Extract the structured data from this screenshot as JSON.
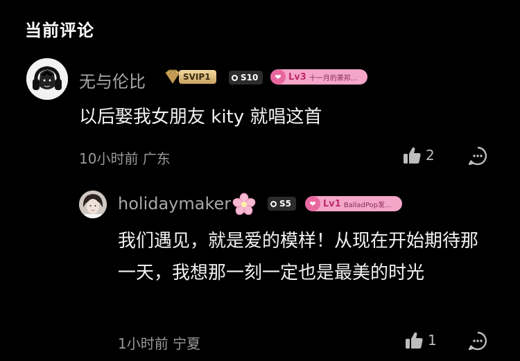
{
  "header": {
    "title": "当前评论"
  },
  "comment": {
    "username": "无与伦比",
    "svip_label": "SVIP1",
    "s_badge": "S10",
    "level": "Lv3",
    "level_name": "十一月的萧邦...",
    "text": "以后娶我女朋友 kity 就唱这首",
    "meta": "10小时前 广东",
    "likes": "2"
  },
  "reply": {
    "username": "holidaymaker",
    "s_badge": "S5",
    "level": "Lv1",
    "level_name": "BalladPop发...",
    "text": "我们遇见，就是爱的模样！从现在开始期待那一天，我想那一刻一定也是最美的时光",
    "meta": "1小时前 宁夏",
    "likes": "1"
  },
  "icons": {
    "like": "thumbs-up-icon",
    "reply": "comment-bubble-icon",
    "svip": "diamond-icon",
    "level": "heart-icon",
    "flower": "cherry-blossom-icon"
  },
  "colors": {
    "background": "#000000",
    "username": "#a9a9a9",
    "text": "#f2f2f2",
    "meta": "#9a9a9a",
    "level_badge": "#f4a6c9",
    "svip_gold": "#d6b26e"
  }
}
